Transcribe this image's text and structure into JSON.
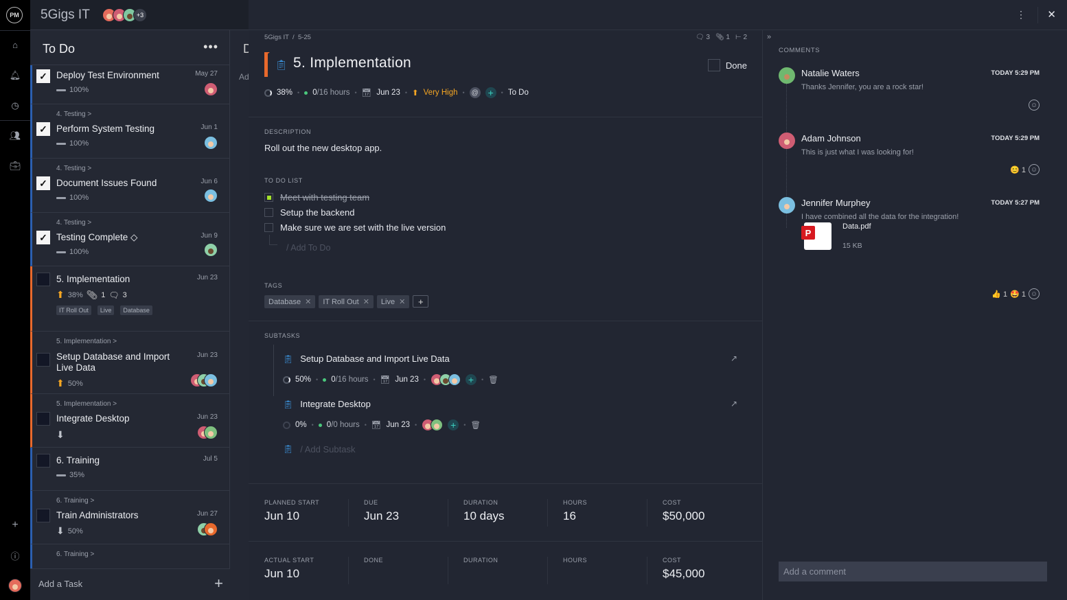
{
  "app": {
    "logo": "PM",
    "project_name": "5Gigs IT",
    "extra_members": "+3"
  },
  "colors": {
    "accent_orange": "#e8692c",
    "accent_blue": "#2b5fb0",
    "priority": "#f5a623",
    "teal": "#3cd0c0",
    "todo_check": "#a4e22a"
  },
  "rail": {
    "icons": [
      "home-icon",
      "bell-icon",
      "clock-icon",
      "people-icon",
      "briefcase-icon",
      "plus-icon",
      "help-icon",
      "user-avatar"
    ]
  },
  "board": {
    "column_title": "To Do",
    "next_column_initial": "D",
    "next_column_add": "Ad",
    "add_task_label": "Add a Task",
    "cards": [
      {
        "parent": "",
        "title": "Deploy Test Environment",
        "date": "May 27",
        "checked": true,
        "progress": "100%",
        "priority": "none"
      },
      {
        "parent": "4. Testing >",
        "title": "Perform System Testing",
        "date": "Jun 1",
        "checked": true,
        "progress": "100%",
        "priority": "none"
      },
      {
        "parent": "4. Testing >",
        "title": "Document Issues Found",
        "date": "Jun 6",
        "checked": true,
        "progress": "100%",
        "priority": "none"
      },
      {
        "parent": "4. Testing >",
        "title": "Testing Complete ◇",
        "date": "Jun 9",
        "checked": true,
        "progress": "100%",
        "priority": "none"
      },
      {
        "parent": "",
        "title": "5. Implementation",
        "date": "Jun 23",
        "checked": false,
        "progress": "38%",
        "priority": "up",
        "attachments": "1",
        "comments": "3",
        "tags": [
          "IT Roll Out",
          "Live",
          "Database"
        ]
      },
      {
        "parent": "5. Implementation >",
        "title": "Setup Database and Import Live Data",
        "date": "Jun 23",
        "checked": false,
        "progress": "50%",
        "priority": "up"
      },
      {
        "parent": "5. Implementation >",
        "title": "Integrate Desktop",
        "date": "Jun 23",
        "checked": false,
        "progress": "",
        "priority": "down"
      },
      {
        "parent": "",
        "title": "6. Training",
        "date": "Jul 5",
        "checked": false,
        "progress": "35%",
        "priority": "none"
      },
      {
        "parent": "6. Training >",
        "title": "Train Administrators",
        "date": "Jun 27",
        "checked": false,
        "progress": "50%",
        "priority": "down"
      },
      {
        "parent": "6. Training >",
        "title": "",
        "date": "",
        "checked": false,
        "progress": "",
        "priority": "none"
      }
    ]
  },
  "detail": {
    "breadcrumb": {
      "project": "5Gigs IT",
      "separator": "/",
      "id": "5-25"
    },
    "counts": {
      "comments": "3",
      "attachments": "1",
      "subtasks": "2"
    },
    "title": "5. Implementation",
    "done_label": "Done",
    "meta": {
      "progress": "38%",
      "hours_done": "0",
      "hours_total": "/16 hours",
      "due": "Jun 23",
      "priority": "Very High",
      "status": "To Do"
    },
    "description_label": "DESCRIPTION",
    "description": "Roll out the new desktop app.",
    "todo_label": "TO DO LIST",
    "todos": [
      {
        "text": "Meet with testing team",
        "done": true
      },
      {
        "text": "Setup the backend",
        "done": false
      },
      {
        "text": "Make sure we are set with the live version",
        "done": false
      }
    ],
    "add_todo_placeholder": "/ Add To Do",
    "tags_label": "TAGS",
    "tags": [
      "Database",
      "IT Roll Out",
      "Live"
    ],
    "subtasks_label": "SUBTASKS",
    "subtasks": [
      {
        "title": "Setup Database and Import Live Data",
        "progress": "50%",
        "hours_done": "0",
        "hours_total": "/16 hours",
        "due": "Jun 23"
      },
      {
        "title": "Integrate Desktop",
        "progress": "0%",
        "hours_done": "0",
        "hours_total": "/0 hours",
        "due": "Jun 23"
      }
    ],
    "add_subtask_placeholder": "/ Add Subtask",
    "planned": [
      {
        "label": "PLANNED START",
        "value": "Jun 10"
      },
      {
        "label": "DUE",
        "value": "Jun 23"
      },
      {
        "label": "DURATION",
        "value": "10 days"
      },
      {
        "label": "HOURS",
        "value": "16"
      },
      {
        "label": "COST",
        "value": "$50,000"
      }
    ],
    "actual": [
      {
        "label": "ACTUAL START",
        "value": "Jun 10"
      },
      {
        "label": "DONE",
        "value": ""
      },
      {
        "label": "DURATION",
        "value": ""
      },
      {
        "label": "HOURS",
        "value": ""
      },
      {
        "label": "COST",
        "value": "$45,000"
      }
    ]
  },
  "comments": {
    "label": "COMMENTS",
    "items": [
      {
        "name": "Natalie Waters",
        "time": "TODAY 5:29 PM",
        "text": "Thanks Jennifer, you are a rock star!"
      },
      {
        "name": "Adam Johnson",
        "time": "TODAY 5:29 PM",
        "text": "This is just what I was looking for!",
        "reactions": [
          {
            "emoji": "😊",
            "count": "1"
          }
        ]
      },
      {
        "name": "Jennifer Murphey",
        "time": "TODAY 5:27 PM",
        "text": "I have combined all the data for the integration!",
        "attachment": {
          "name": "Data.pdf",
          "size": "15 KB"
        },
        "reactions": [
          {
            "emoji": "👍",
            "count": "1"
          },
          {
            "emoji": "🤩",
            "count": "1"
          }
        ]
      }
    ],
    "input_placeholder": "Add a comment"
  }
}
